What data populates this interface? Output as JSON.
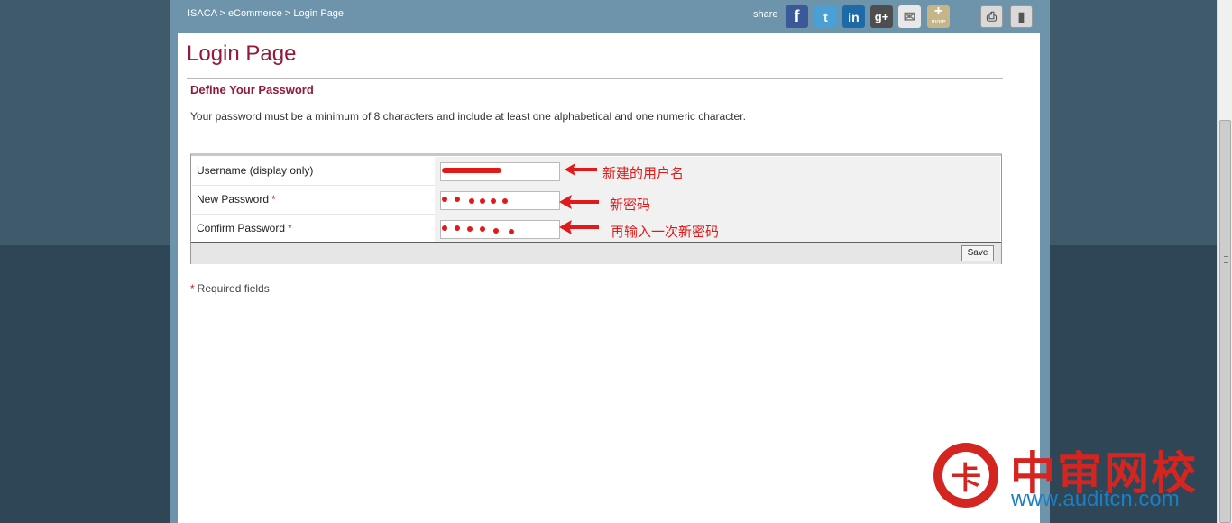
{
  "breadcrumb": "ISACA > eCommerce > Login Page",
  "share": {
    "label": "share",
    "icons": [
      "facebook-icon",
      "twitter-icon",
      "linkedin-icon",
      "google-plus-icon",
      "email-icon",
      "more-icon"
    ],
    "more_label": "more"
  },
  "page": {
    "title": "Login Page",
    "section_title": "Define Your Password",
    "instructions": "Your password must be a minimum of 8 characters and include at least one alphabetical and one numeric character."
  },
  "form": {
    "rows": [
      {
        "label": "Username (display only)",
        "required": false
      },
      {
        "label": "New Password",
        "required": true
      },
      {
        "label": "Confirm Password",
        "required": true
      }
    ],
    "required_mark": "*",
    "save_label": "Save"
  },
  "required_note": {
    "mark": "*",
    "text": "Required fields"
  },
  "annotations": {
    "username": "新建的用户名",
    "new_password": "新密码",
    "confirm_password": "再输入一次新密码"
  },
  "watermark": {
    "brand": "中审网校",
    "url": "www.auditcn.com"
  },
  "colors": {
    "accent": "#93193b",
    "annotation": "#e31919",
    "frame": "#6e94ab"
  }
}
